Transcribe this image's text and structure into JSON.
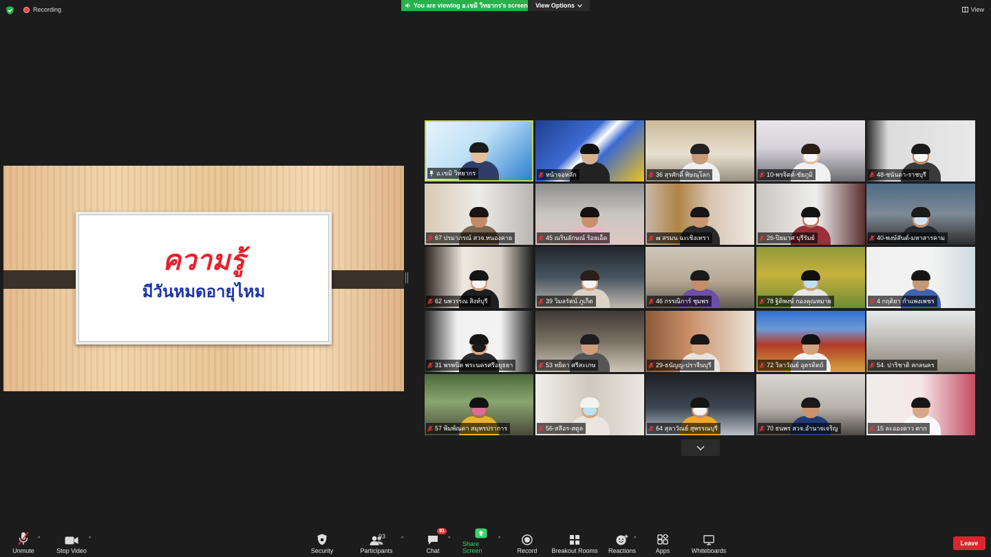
{
  "top": {
    "recording_label": "Recording",
    "banner_text": "You are viewing อ.เขมิ วิทยากร's screen",
    "view_options_label": "View Options",
    "view_label": "View"
  },
  "shared_slide": {
    "title": "ความรู้",
    "subtitle": "มีวันหมดอายุไหม"
  },
  "participants": [
    {
      "name": "อ.เขมิ วิทยากร",
      "muted": false,
      "pinned": true,
      "active": true,
      "scene": "presenter"
    },
    {
      "name": "หน้าจอหลัก",
      "muted": true,
      "scene": "poster"
    },
    {
      "name": "36 สุรศักดิ์ พิษณุโลก",
      "muted": true,
      "scene": "office"
    },
    {
      "name": "10-พรจิตต์-ชัยภูมิ",
      "muted": true,
      "scene": "mask_room"
    },
    {
      "name": "48-ชนันดา-ราชบุรี",
      "muted": true,
      "scene": "mask_woman"
    },
    {
      "name": "67 ปรมาภรณ์ สวจ.หนองคาย",
      "muted": true,
      "scene": "woman_glasses"
    },
    {
      "name": "45 ณรินลักษณ์ ร้อยเอ็ด",
      "muted": true,
      "scene": "woman_office"
    },
    {
      "name": "๗ สรมน ฉะเชิงเทรา",
      "muted": true,
      "scene": "portrait_wall"
    },
    {
      "name": "26-ปิยมาศ บุรีรัมย์",
      "muted": true,
      "scene": "mask_red"
    },
    {
      "name": "40-พงษ์สันต์-มหาสารคาม",
      "muted": true,
      "scene": "mask_man"
    },
    {
      "name": "62 นพวรรณ สิงห์บุรี",
      "muted": true,
      "scene": "mask_dark"
    },
    {
      "name": "39 วิมลรัตน์ ภูเก็ต",
      "muted": true,
      "scene": "mask_office"
    },
    {
      "name": "46 กรรณิการ์ ชุมพร",
      "muted": true,
      "scene": "purple_office"
    },
    {
      "name": "78 ฐิติพงษ์ กองคุณหมาย",
      "muted": true,
      "scene": "garden"
    },
    {
      "name": "4 กฤติยา กำแพงเพชร",
      "muted": true,
      "scene": "blue_woman"
    },
    {
      "name": "31 พรพนิต พระนครศรีอยุธยา",
      "muted": true,
      "scene": "black_mask"
    },
    {
      "name": "53 ทยิดา ศรีสะเกษ",
      "muted": true,
      "scene": "glasses_desk"
    },
    {
      "name": "29-ธนัญญ-ปราจีนบุรี",
      "muted": true,
      "scene": "closeup"
    },
    {
      "name": "72 วิลาวัณย์ อุตรดิตถ์",
      "muted": true,
      "scene": "temple"
    },
    {
      "name": "54. ปาริชาติ สกลนคร",
      "muted": true,
      "scene": "flood"
    },
    {
      "name": "57 พิมพ์ณดา สมุทรปราการ",
      "muted": true,
      "scene": "pink_mask"
    },
    {
      "name": "56-สลีอร-สตูล",
      "muted": true,
      "scene": "hijab"
    },
    {
      "name": "64 สุลาวัณย์ สุพรรณบุรี",
      "muted": true,
      "scene": "dark_office"
    },
    {
      "name": "70 ธนพร สวจ.อำนาจเจริญ",
      "muted": true,
      "scene": "blue_shirt"
    },
    {
      "name": "15 ละอองดาว ตาก",
      "muted": true,
      "scene": "bright_room"
    }
  ],
  "toolbar": {
    "unmute": "Unmute",
    "stop_video": "Stop Video",
    "security": "Security",
    "participants": "Participants",
    "participants_count": "93",
    "chat": "Chat",
    "chat_badge": "91",
    "share_screen": "Share Screen",
    "record": "Record",
    "breakout_rooms": "Breakout Rooms",
    "reactions": "Reactions",
    "apps": "Apps",
    "whiteboards": "Whiteboards",
    "leave": "Leave"
  },
  "colors": {
    "background": "#1c1c1c",
    "banner_green": "#27b24a",
    "share_green": "#3ed36a",
    "leave_red": "#d7282f",
    "active_speaker": "#c3d94a",
    "muted_mic_red": "#e0383e"
  },
  "icons": {
    "security": "shield-icon",
    "mic": "mic-off-icon",
    "video": "video-camera-icon",
    "participants": "people-icon",
    "chat": "chat-bubble-icon",
    "share": "share-arrow-icon",
    "record": "record-circle-icon",
    "breakout": "grid-icon",
    "reactions": "smiley-plus-icon",
    "apps": "apps-icon",
    "whiteboards": "whiteboard-icon"
  }
}
